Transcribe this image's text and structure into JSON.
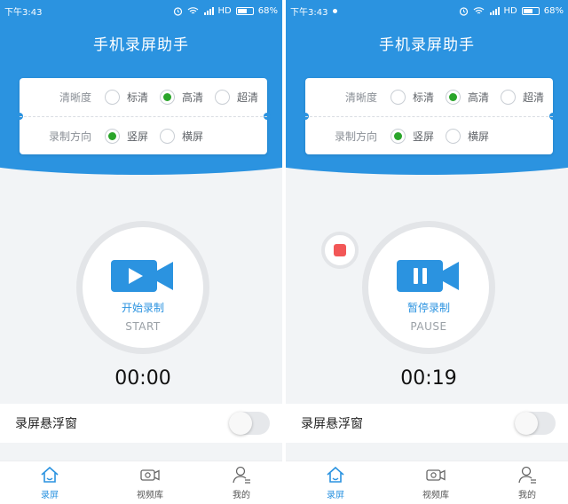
{
  "colors": {
    "primary": "#2b93e0",
    "radio_checked": "#2aa52a",
    "stop": "#f25757"
  },
  "screens": [
    {
      "status_bar": {
        "time": "下午3:43",
        "network": "HD",
        "battery": "68%"
      },
      "title": "手机录屏助手",
      "settings": {
        "quality": {
          "label": "清晰度",
          "options": [
            "标清",
            "高清",
            "超清"
          ],
          "selected": "高清"
        },
        "orientation": {
          "label": "录制方向",
          "options": [
            "竖屏",
            "横屏"
          ],
          "selected": "竖屏"
        }
      },
      "record": {
        "state": "idle",
        "label": "开始录制",
        "sublabel": "START",
        "icon": "play-icon"
      },
      "timer": "00:00",
      "float_window": {
        "label": "录屏悬浮窗",
        "enabled": false
      },
      "nav": {
        "items": [
          {
            "label": "录屏",
            "icon": "home-icon"
          },
          {
            "label": "视频库",
            "icon": "video-library-icon"
          },
          {
            "label": "我的",
            "icon": "user-icon"
          }
        ],
        "active": "录屏"
      }
    },
    {
      "status_bar": {
        "time": "下午3:43",
        "network": "HD",
        "battery": "68%"
      },
      "title": "手机录屏助手",
      "settings": {
        "quality": {
          "label": "清晰度",
          "options": [
            "标清",
            "高清",
            "超清"
          ],
          "selected": "高清"
        },
        "orientation": {
          "label": "录制方向",
          "options": [
            "竖屏",
            "横屏"
          ],
          "selected": "竖屏"
        }
      },
      "record": {
        "state": "recording",
        "label": "暂停录制",
        "sublabel": "PAUSE",
        "icon": "pause-icon"
      },
      "stop_button": {
        "icon": "stop-icon"
      },
      "timer": "00:19",
      "float_window": {
        "label": "录屏悬浮窗",
        "enabled": false
      },
      "nav": {
        "items": [
          {
            "label": "录屏",
            "icon": "home-icon"
          },
          {
            "label": "视频库",
            "icon": "video-library-icon"
          },
          {
            "label": "我的",
            "icon": "user-icon"
          }
        ],
        "active": "录屏"
      }
    }
  ]
}
